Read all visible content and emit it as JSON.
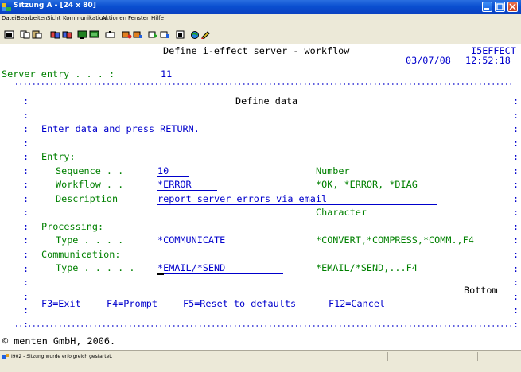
{
  "window": {
    "title": "Sitzung A - [24 x 80]"
  },
  "menubar": {
    "items": [
      "Datei",
      "Bearbeiten",
      "Sicht",
      "Kommunikation",
      "Aktionen",
      "Fenster",
      "Hilfe"
    ]
  },
  "screen": {
    "header_title": "Define i-effect server - workflow",
    "header_program": "I5EFFECT",
    "header_date": "03/07/08",
    "header_time": "12:52:18",
    "server_entry_label": "Server entry . . . :",
    "server_entry_value": "11",
    "popup_title": "Define data",
    "instruction": "Enter data and press RETURN.",
    "entry_label": "Entry:",
    "sequence_label": "Sequence . .",
    "sequence_value": "10",
    "sequence_hint": "Number",
    "workflow_label": "Workflow . .",
    "workflow_value": "*ERROR",
    "workflow_hint": "*OK, *ERROR, *DIAG",
    "description_label": "Description",
    "description_value": "report server errors via email",
    "description_hint": "Character",
    "processing_label": "Processing:",
    "proc_type_label": "Type . . . .",
    "proc_type_value": "*COMMUNICATE",
    "proc_type_hint": "*CONVERT,*COMPRESS,*COMM.,F4",
    "communication_label": "Communication:",
    "comm_type_label": "Type . . . . .",
    "comm_type_value": "*EMAIL/*SEND",
    "comm_type_hint": "*EMAIL/*SEND,...F4",
    "bottom_label": "Bottom",
    "fkeys": [
      "F3=Exit",
      "F4=Prompt",
      "F5=Reset to defaults",
      "F12=Cancel"
    ],
    "copyright": "© menten GmbH, 2006."
  },
  "statusbar": {
    "message": "I902 - Sitzung wurde erfolgreich gestartet."
  },
  "colors": {
    "title_blue": "#0a4fd0",
    "screen_bg": "#ffffff",
    "field_blue": "#0000cc",
    "label_green": "#008000"
  }
}
